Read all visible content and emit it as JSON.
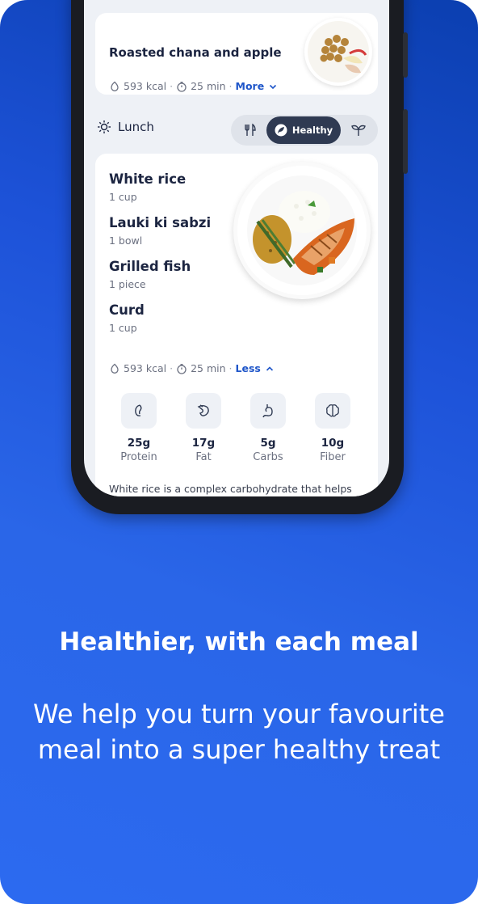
{
  "snack": {
    "name": "Roasted chana and apple",
    "kcal": "593 kcal",
    "time": "25 min",
    "toggle": "More"
  },
  "lunch": {
    "title": "Lunch",
    "segments": {
      "active_label": "Healthy"
    },
    "items": [
      {
        "name": "White rice",
        "qty": "1 cup"
      },
      {
        "name": "Lauki ki sabzi",
        "qty": "1 bowl"
      },
      {
        "name": "Grilled fish",
        "qty": "1 piece"
      },
      {
        "name": "Curd",
        "qty": "1 cup"
      }
    ],
    "kcal": "593 kcal",
    "time": "25 min",
    "toggle": "Less",
    "nutrients": [
      {
        "value": "25g",
        "label": "Protein"
      },
      {
        "value": "17g",
        "label": "Fat"
      },
      {
        "value": "5g",
        "label": "Carbs"
      },
      {
        "value": "10g",
        "label": "Fiber"
      }
    ],
    "description": "White rice is a complex carbohydrate that helps"
  },
  "promo": {
    "headline": "Healthier, with each meal",
    "sub_line1": "We help you turn your favourite",
    "sub_line2": "meal into a super healthy treat"
  },
  "colors": {
    "accent": "#1f56c9",
    "background": "#2a66e8",
    "segment_active": "#2f3a52"
  }
}
